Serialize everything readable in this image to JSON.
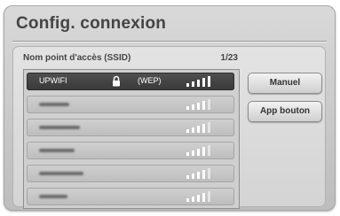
{
  "window": {
    "title": "Config. connexion"
  },
  "list": {
    "header_label": "Nom point d'accès (SSID)",
    "count": "1/23",
    "rows": [
      {
        "ssid": "UPWIFI",
        "security": "(WEP)",
        "locked": true,
        "selected": true,
        "signal_bars": 5
      },
      {
        "ssid": "",
        "security": "",
        "locked": false,
        "selected": false,
        "signal_bars": 5
      },
      {
        "ssid": "",
        "security": "",
        "locked": false,
        "selected": false,
        "signal_bars": 5
      },
      {
        "ssid": "",
        "security": "",
        "locked": false,
        "selected": false,
        "signal_bars": 5
      },
      {
        "ssid": "",
        "security": "",
        "locked": false,
        "selected": false,
        "signal_bars": 5
      },
      {
        "ssid": "",
        "security": "",
        "locked": false,
        "selected": false,
        "signal_bars": 5
      }
    ]
  },
  "buttons": {
    "manual_label": "Manuel",
    "app_button_label": "App bouton"
  },
  "icons": {
    "lock": "lock-icon",
    "signal": "wifi-signal-icon"
  },
  "colors": {
    "selected_row": "#3f3f3f",
    "background": "#c9c9c9"
  }
}
